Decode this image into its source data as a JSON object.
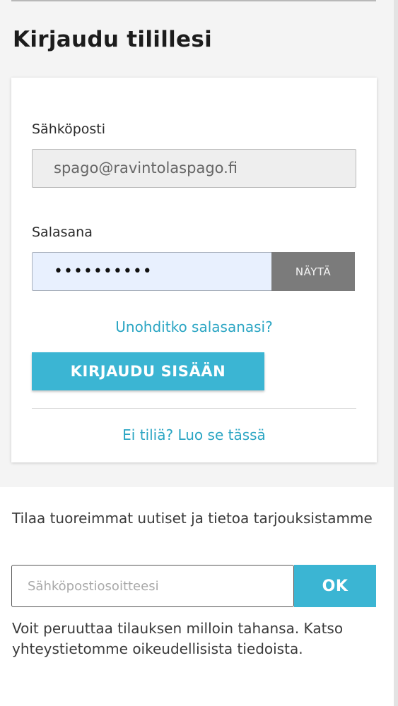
{
  "login": {
    "title": "Kirjaudu tilillesi",
    "email_label": "Sähköposti",
    "email_value": "spago@ravintolaspago.fi",
    "password_label": "Salasana",
    "password_value": "••••••••••",
    "show_label": "NÄYTÄ",
    "forgot_link": "Unohditko salasanasi?",
    "login_button": "KIRJAUDU SISÄÄN",
    "register_link": "Ei tiliä? Luo se tässä"
  },
  "newsletter": {
    "text": "Tilaa tuoreimmat uutiset ja tietoa tarjouksistamme",
    "placeholder": "Sähköpostiosoitteesi",
    "ok_label": "OK",
    "disclaimer": "Voit peruuttaa tilauksen milloin tahansa. Katso yhteystietomme oikeudellisista tiedoista."
  },
  "colors": {
    "accent": "#3bb5d3",
    "link": "#2aa5c3",
    "show_button": "#7b7b7b",
    "autofill": "#e8f0fe"
  }
}
